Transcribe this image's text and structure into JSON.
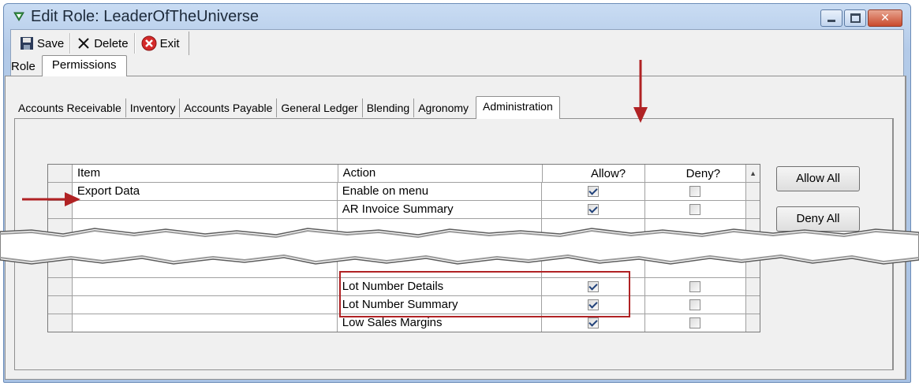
{
  "window": {
    "title": "Edit Role: LeaderOfTheUniverse",
    "icon": "green-check-arrow-icon"
  },
  "toolbar": {
    "save_label": "Save",
    "delete_label": "Delete",
    "exit_label": "Exit"
  },
  "outer_tabs": [
    "Role",
    "Permissions"
  ],
  "outer_active": "Permissions",
  "inner_tabs": [
    "Accounts Receivable",
    "Inventory",
    "Accounts Payable",
    "General Ledger",
    "Blending",
    "Agronomy",
    "Administration"
  ],
  "inner_active": "Administration",
  "grid": {
    "columns": [
      "Item",
      "Action",
      "Allow?",
      "Deny?"
    ],
    "rows_top": [
      {
        "item": "Export Data",
        "action": "Enable on menu",
        "allow": true,
        "deny": false
      },
      {
        "item": "",
        "action": "AR Invoice Summary",
        "allow": true,
        "deny": false
      }
    ],
    "rows_bottom": [
      {
        "item": "",
        "action": "Lot Number Details",
        "allow": true,
        "deny": false
      },
      {
        "item": "",
        "action": "Lot Number Summary",
        "allow": true,
        "deny": false
      },
      {
        "item": "",
        "action": "Low Sales Margins",
        "allow": true,
        "deny": false
      }
    ]
  },
  "buttons": {
    "allow_all": "Allow All",
    "deny_all": "Deny All"
  },
  "colors": {
    "annotation_red": "#b02224",
    "titlebar_blue": "#b3cae8"
  }
}
